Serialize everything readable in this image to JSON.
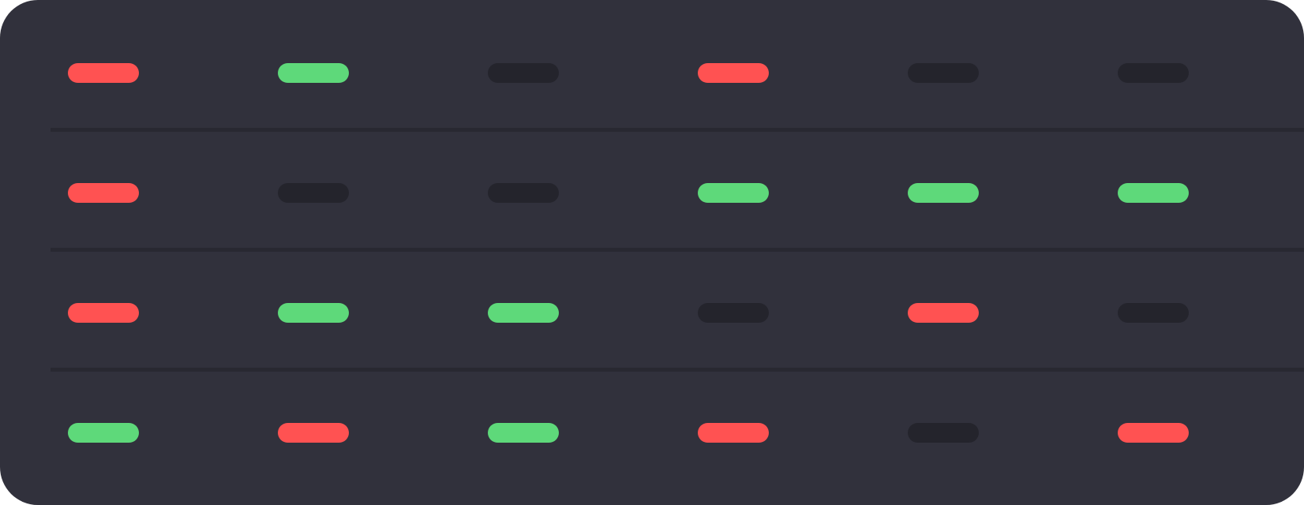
{
  "palette": {
    "background": "#31313c",
    "divider": "#282831",
    "red": "#ff5252",
    "green": "#5ed97a",
    "off": "#24242c"
  },
  "grid": {
    "rows": [
      [
        "red",
        "green",
        "off",
        "red",
        "off",
        "off"
      ],
      [
        "red",
        "off",
        "off",
        "green",
        "green",
        "green"
      ],
      [
        "red",
        "green",
        "green",
        "off",
        "red",
        "off"
      ],
      [
        "green",
        "red",
        "green",
        "red",
        "off",
        "red"
      ]
    ]
  }
}
